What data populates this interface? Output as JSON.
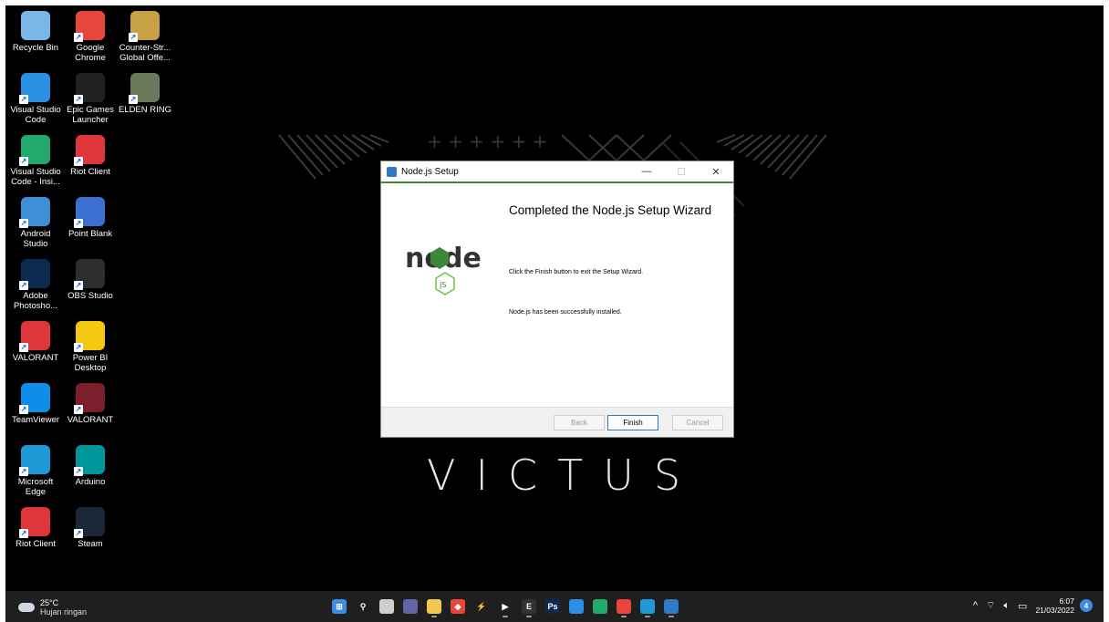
{
  "desktop_icons": [
    {
      "label": "Recycle Bin",
      "icon": "recycle-bin-icon",
      "color": "#7ab6e8"
    },
    {
      "label": "Google Chrome",
      "icon": "chrome-icon",
      "color": "#e8453c"
    },
    {
      "label": "Counter-Str... Global Offe...",
      "icon": "csgo-icon",
      "color": "#c8a046"
    },
    {
      "label": "Visual Studio Code",
      "icon": "vscode-icon",
      "color": "#2b8fe3"
    },
    {
      "label": "Epic Games Launcher",
      "icon": "epic-games-icon",
      "color": "#222222"
    },
    {
      "label": "ELDEN RING",
      "icon": "elden-ring-icon",
      "color": "#6b7a5a"
    },
    {
      "label": "Visual Studio Code - Insi...",
      "icon": "vscode-insiders-icon",
      "color": "#23a86d"
    },
    {
      "label": "Riot Client",
      "icon": "riot-client-icon",
      "color": "#e0353a"
    },
    {
      "label": "Android Studio",
      "icon": "android-studio-icon",
      "color": "#3f8fd6"
    },
    {
      "label": "Point Blank",
      "icon": "point-blank-icon",
      "color": "#3b6fd1"
    },
    {
      "label": "Adobe Photosho...",
      "icon": "photoshop-icon",
      "color": "#0c2a4d"
    },
    {
      "label": "OBS Studio",
      "icon": "obs-icon",
      "color": "#2d2d2d"
    },
    {
      "label": "VALORANT",
      "icon": "valorant-riot-icon",
      "color": "#e0353a"
    },
    {
      "label": "Power BI Desktop",
      "icon": "power-bi-icon",
      "color": "#f2c811"
    },
    {
      "label": "TeamViewer",
      "icon": "teamviewer-icon",
      "color": "#0e8ee9"
    },
    {
      "label": "VALORANT",
      "icon": "valorant-icon",
      "color": "#7a1f2b"
    },
    {
      "label": "Microsoft Edge",
      "icon": "edge-icon",
      "color": "#1f9ad6"
    },
    {
      "label": "Arduino",
      "icon": "arduino-icon",
      "color": "#00979c"
    },
    {
      "label": "Riot Client",
      "icon": "riot-client-icon",
      "color": "#e0353a"
    },
    {
      "label": "Steam",
      "icon": "steam-icon",
      "color": "#1b2838"
    }
  ],
  "wallpaper": {
    "brand": "VICTUS"
  },
  "dialog": {
    "title": "Node.js Setup",
    "heading": "Completed the Node.js Setup Wizard",
    "message1": "Click the Finish button to exit the Setup Wizard.",
    "message2": "Node.js has been successfully installed.",
    "logo_text": "node",
    "logo_badge": "JS",
    "buttons": {
      "back": "Back",
      "finish": "Finish",
      "cancel": "Cancel"
    },
    "controls": {
      "minimize": "—",
      "maximize": "☐",
      "close": "✕"
    },
    "accent": "#3c873a"
  },
  "taskbar": {
    "weather_temp": "25°C",
    "weather_desc": "Hujan ringan",
    "apps": [
      {
        "name": "start",
        "icon": "windows-start-icon",
        "color": "#3d8be3",
        "glyph": "⊞",
        "running": false
      },
      {
        "name": "search",
        "icon": "search-icon",
        "color": "transparent",
        "glyph": "⚲",
        "running": false
      },
      {
        "name": "task-view",
        "icon": "task-view-icon",
        "color": "#cfcfcf",
        "glyph": "",
        "running": false
      },
      {
        "name": "chat",
        "icon": "chat-icon",
        "color": "#6264a7",
        "glyph": "",
        "running": false
      },
      {
        "name": "file-explorer",
        "icon": "folder-icon",
        "color": "#f2c94c",
        "glyph": "",
        "running": true
      },
      {
        "name": "git-app",
        "icon": "diamond-icon",
        "color": "#e8453c",
        "glyph": "◆",
        "running": false
      },
      {
        "name": "lightning-app",
        "icon": "lightning-icon",
        "color": "transparent",
        "glyph": "⚡",
        "running": false
      },
      {
        "name": "media-player",
        "icon": "play-icon",
        "color": "transparent",
        "glyph": "▶",
        "running": true
      },
      {
        "name": "epic-games",
        "icon": "epic-games-icon",
        "color": "#333333",
        "glyph": "E",
        "running": true
      },
      {
        "name": "photoshop",
        "icon": "photoshop-icon",
        "color": "#0c2a4d",
        "glyph": "Ps",
        "running": false
      },
      {
        "name": "vscode",
        "icon": "vscode-icon",
        "color": "#2b8fe3",
        "glyph": "",
        "running": false
      },
      {
        "name": "vscode-insiders",
        "icon": "vscode-insiders-icon",
        "color": "#23a86d",
        "glyph": "",
        "running": false
      },
      {
        "name": "chrome",
        "icon": "chrome-icon",
        "color": "#e8453c",
        "glyph": "",
        "running": true
      },
      {
        "name": "edge",
        "icon": "edge-icon",
        "color": "#1f9ad6",
        "glyph": "",
        "running": true
      },
      {
        "name": "nodejs-setup",
        "icon": "installer-icon",
        "color": "#2f79c7",
        "glyph": "",
        "running": true
      }
    ],
    "tray": {
      "chevron": "^",
      "wifi": "⌔",
      "volume": "🔈︎",
      "battery": "▭"
    },
    "time": "6:07",
    "date": "21/03/2022",
    "notifications": "4"
  }
}
